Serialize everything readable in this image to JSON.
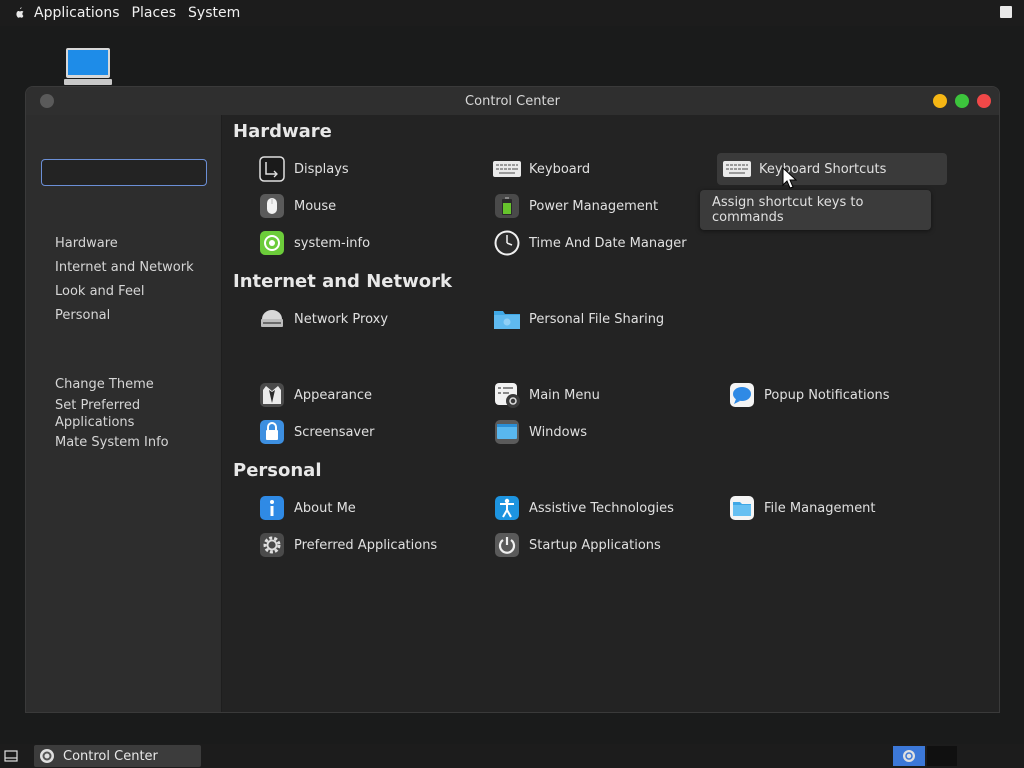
{
  "top_panel": {
    "menus": [
      "Applications",
      "Places",
      "System"
    ]
  },
  "window": {
    "title": "Control Center"
  },
  "search": {
    "value": "",
    "placeholder": ""
  },
  "sidebar": {
    "categories": [
      "Hardware",
      "Internet and Network",
      "Look and Feel",
      "Personal"
    ],
    "tasks": [
      "Change Theme",
      "Set Preferred Applications",
      "Mate System Info"
    ]
  },
  "sections": [
    {
      "title": "Hardware",
      "items": [
        {
          "label": "Displays",
          "icon": "display-icon"
        },
        {
          "label": "Keyboard",
          "icon": "keyboard-icon"
        },
        {
          "label": "Keyboard Shortcuts",
          "icon": "keyboard-shortcuts-icon"
        },
        {
          "label": "Mouse",
          "icon": "mouse-icon"
        },
        {
          "label": "Power Management",
          "icon": "battery-icon"
        },
        {
          "label": "system-info",
          "icon": "system-info-icon"
        },
        {
          "label": "Time And Date Manager",
          "icon": "clock-icon"
        }
      ]
    },
    {
      "title": "Internet and Network",
      "items": [
        {
          "label": "Network Proxy",
          "icon": "network-proxy-icon"
        },
        {
          "label": "Personal File Sharing",
          "icon": "folder-share-icon"
        }
      ]
    },
    {
      "title": "",
      "items": [
        {
          "label": "Appearance",
          "icon": "appearance-icon"
        },
        {
          "label": "Main Menu",
          "icon": "main-menu-icon"
        },
        {
          "label": "Popup Notifications",
          "icon": "notifications-icon"
        },
        {
          "label": "Screensaver",
          "icon": "screensaver-icon"
        },
        {
          "label": "Windows",
          "icon": "windows-icon"
        }
      ]
    },
    {
      "title": "Personal",
      "items": [
        {
          "label": "About Me",
          "icon": "info-icon"
        },
        {
          "label": "Assistive Technologies",
          "icon": "accessibility-icon"
        },
        {
          "label": "File Management",
          "icon": "file-management-icon"
        },
        {
          "label": "Preferred Applications",
          "icon": "gear-icon"
        },
        {
          "label": "Startup Applications",
          "icon": "power-icon"
        }
      ]
    }
  ],
  "tooltip": {
    "text": "Assign shortcut keys to commands"
  },
  "taskbar": {
    "task_label": "Control Center"
  },
  "colors": {
    "accent": "#3c78d8",
    "minimize": "#f5b614",
    "maximize": "#3cc43c",
    "close": "#f04848"
  }
}
